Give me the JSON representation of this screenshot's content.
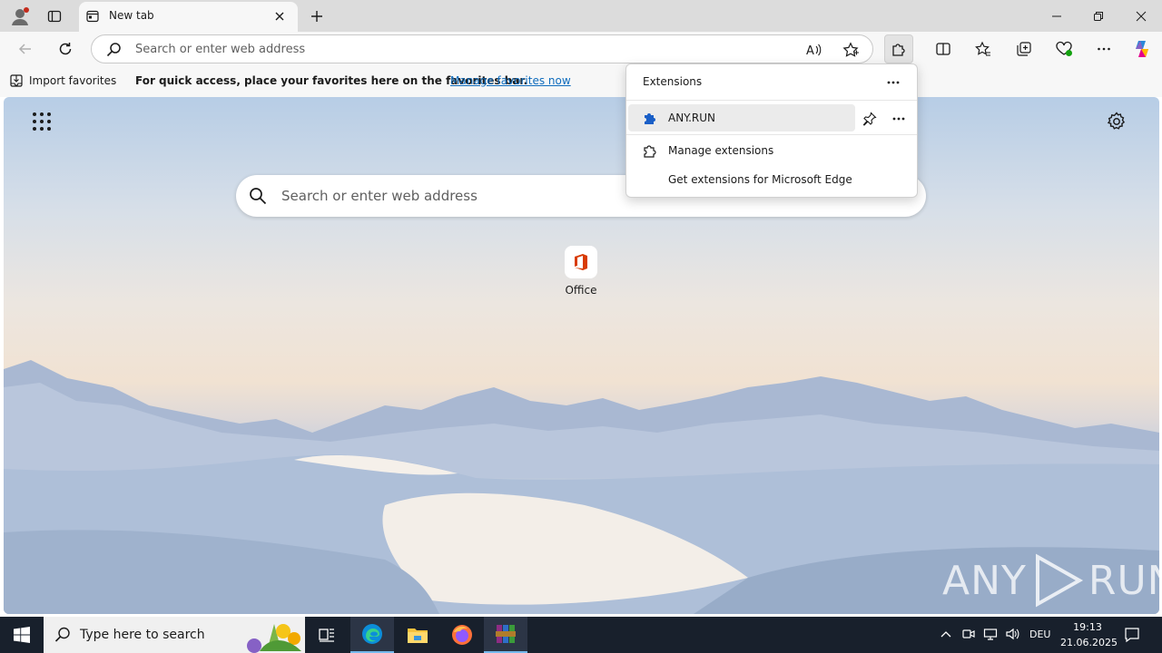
{
  "browser": {
    "tab": {
      "title": "New tab"
    },
    "address_bar": {
      "placeholder": "Search or enter web address"
    },
    "favorites_bar": {
      "import_label": "Import favorites",
      "message": "For quick access, place your favorites here on the favorites bar.",
      "manage_link": "Manage favorites now"
    }
  },
  "new_tab_page": {
    "search_placeholder": "Search or enter web address",
    "tiles": [
      {
        "label": "Office"
      }
    ],
    "watermark": {
      "left": "ANY",
      "right": "RUN"
    }
  },
  "extensions_panel": {
    "title": "Extensions",
    "items": [
      {
        "name": "ANY.RUN"
      }
    ],
    "manage_label": "Manage extensions",
    "get_label": "Get extensions for Microsoft Edge"
  },
  "taskbar": {
    "search_placeholder": "Type here to search",
    "language": "DEU",
    "time": "19:13",
    "date": "21.06.2025"
  },
  "colors": {
    "accent": "#0f6cbd",
    "extension_icon": "#1a5fc7",
    "taskbar": "#18202c",
    "office_red": "#d83b01"
  },
  "icons": [
    "profile-icon",
    "tab-actions-icon",
    "newtab-page-icon",
    "close-tab-icon",
    "new-tab-icon",
    "minimize-icon",
    "restore-icon",
    "close-window-icon",
    "back-icon",
    "refresh-icon",
    "search-icon",
    "read-aloud-icon",
    "favorite-star-icon",
    "extensions-icon",
    "split-screen-icon",
    "favorites-icon",
    "collections-icon",
    "browser-essentials-icon",
    "more-icon",
    "copilot-icon",
    "import-icon",
    "apps-grid-icon",
    "settings-icon",
    "office-icon",
    "more-dots-icon",
    "puzzle-icon",
    "pin-icon",
    "windows-icon",
    "task-view-icon",
    "edge-icon",
    "file-explorer-icon",
    "firefox-icon",
    "winrar-icon",
    "chevron-up-icon",
    "meet-now-icon",
    "network-icon",
    "volume-icon",
    "notification-icon"
  ]
}
